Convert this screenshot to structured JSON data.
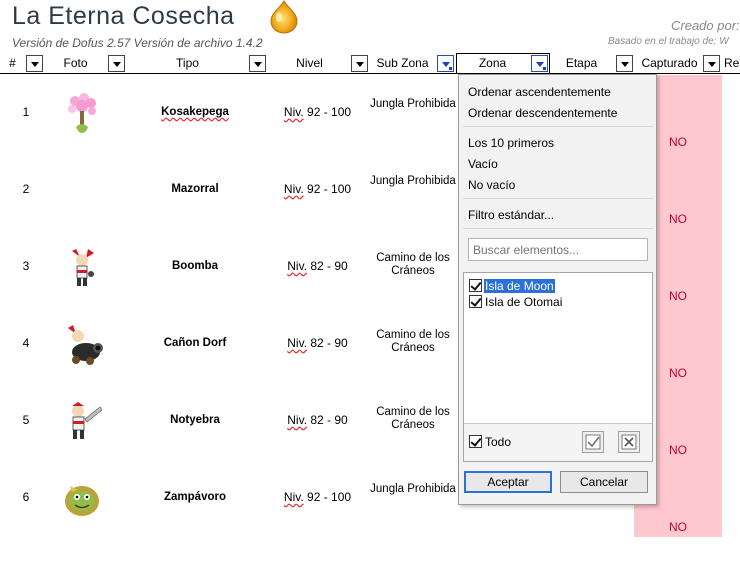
{
  "header": {
    "title": "La Eterna Cosecha",
    "subtitle": "Versión de Dofus 2.57 Versión de archivo 1.4.2",
    "created_by": "Creado por:",
    "based_on": "Basado en el trabajo de: W"
  },
  "columns": [
    "#",
    "Foto",
    "Tipo",
    "Nivel",
    "Sub Zona",
    "Zona",
    "Etapa",
    "Capturado",
    "Re"
  ],
  "rows": [
    {
      "num": "1",
      "tipo": "Kosakepega",
      "nivel_prefix": "Niv.",
      "nivel_range": " 92 - 100",
      "subzona": "Jungla Prohibida",
      "capturado": "NO"
    },
    {
      "num": "2",
      "tipo": "Mazorral",
      "nivel_prefix": "Niv.",
      "nivel_range": " 92 - 100",
      "subzona": "Jungla Prohibida",
      "capturado": "NO"
    },
    {
      "num": "3",
      "tipo": "Boomba",
      "nivel_prefix": "Niv.",
      "nivel_range": " 82 - 90",
      "subzona": "Camino de los Cráneos",
      "capturado": "NO"
    },
    {
      "num": "4",
      "tipo": "Cañon Dorf",
      "nivel_prefix": "Niv.",
      "nivel_range": " 82 - 90",
      "subzona": "Camino de los Cráneos",
      "capturado": "NO"
    },
    {
      "num": "5",
      "tipo": "Notyebra",
      "nivel_prefix": "Niv.",
      "nivel_range": " 82 - 90",
      "subzona": "Camino de los Cráneos",
      "capturado": "NO"
    },
    {
      "num": "6",
      "tipo": "Zampávoro",
      "nivel_prefix": "Niv.",
      "nivel_range": " 92 - 100",
      "subzona": "Jungla Prohibida",
      "capturado": "NO"
    }
  ],
  "filter": {
    "sort_asc": "Ordenar ascendentemente",
    "sort_desc": "Ordenar descendentemente",
    "top10": "Los 10 primeros",
    "empty": "Vacío",
    "not_empty": "No vacío",
    "standard": "Filtro estándar...",
    "search_placeholder": "Buscar elementos...",
    "items": [
      {
        "label": "Isla de Moon",
        "checked": true,
        "selected": true
      },
      {
        "label": "Isla de Otomai",
        "checked": true,
        "selected": false
      }
    ],
    "all_label": "Todo",
    "accept": "Aceptar",
    "cancel": "Cancelar"
  },
  "colors": {
    "capturado_bg": "#ffc7ce",
    "capturado_text": "#c0002e",
    "selection": "#2b6fd9"
  }
}
